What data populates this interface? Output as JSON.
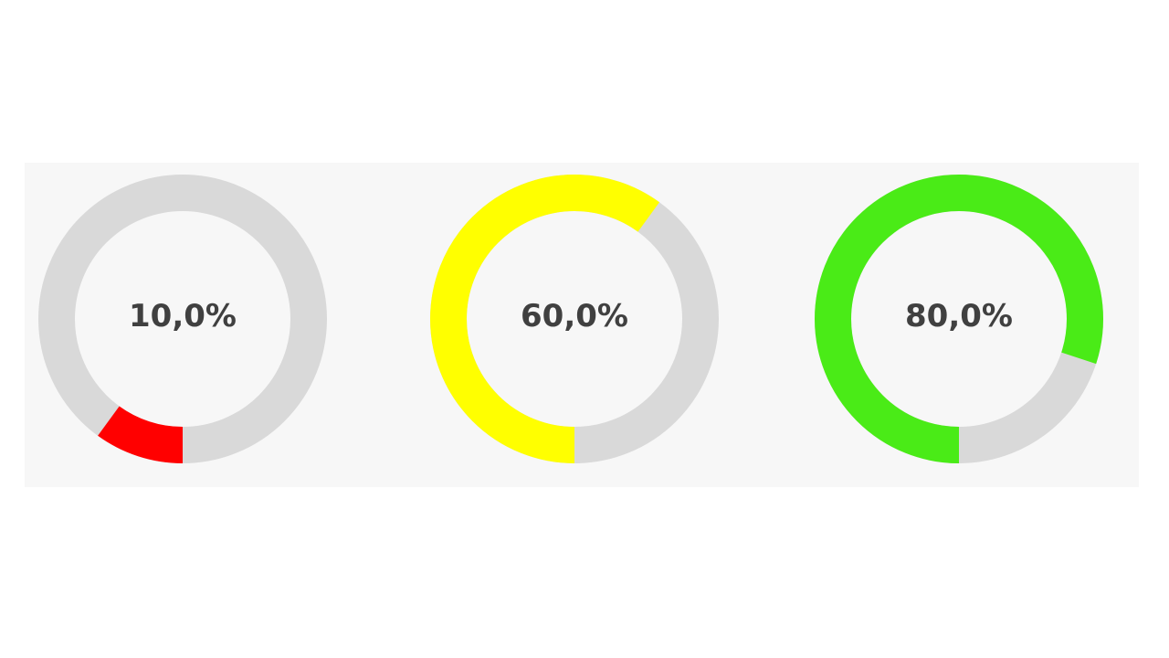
{
  "chart_data": {
    "type": "pie",
    "track_color": "#d9d9d9",
    "panel_color": "#f7f7f7",
    "gauges": [
      {
        "label": "10,0%",
        "value": 10,
        "color": "#ff0000"
      },
      {
        "label": "60,0%",
        "value": 60,
        "color": "#ffff00"
      },
      {
        "label": "80,0%",
        "value": 80,
        "color": "#4aeb17"
      }
    ]
  }
}
